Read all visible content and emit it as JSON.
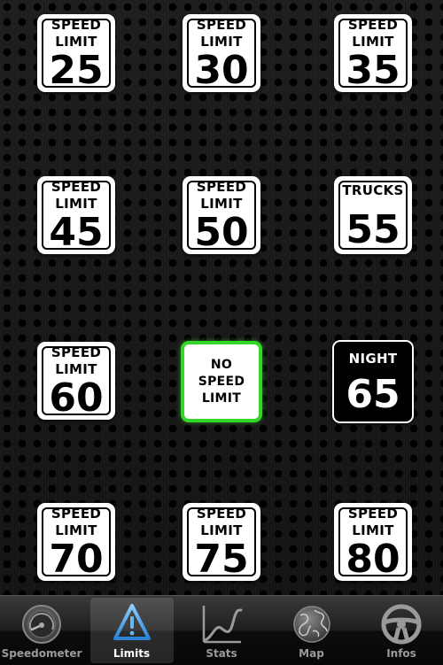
{
  "colors": {
    "selected_border": "#35d62a",
    "sign_background": "#ffffff",
    "night_sign_background": "#000000",
    "tab_active_icon": "#4aa3e6"
  },
  "signs": [
    {
      "line1": "SPEED",
      "line2": "LIMIT",
      "number": "25"
    },
    {
      "line1": "SPEED",
      "line2": "LIMIT",
      "number": "30"
    },
    {
      "line1": "SPEED",
      "line2": "LIMIT",
      "number": "35"
    },
    {
      "line1": "SPEED",
      "line2": "LIMIT",
      "number": "45"
    },
    {
      "line1": "SPEED",
      "line2": "LIMIT",
      "number": "50"
    },
    {
      "line1": "TRUCKS",
      "number": "55"
    },
    {
      "line1": "SPEED",
      "line2": "LIMIT",
      "number": "60"
    },
    {
      "line1": "NO",
      "line2": "SPEED",
      "line3": "LIMIT",
      "selected": true
    },
    {
      "line1": "NIGHT",
      "number": "65"
    },
    {
      "line1": "SPEED",
      "line2": "LIMIT",
      "number": "70"
    },
    {
      "line1": "SPEED",
      "line2": "LIMIT",
      "number": "75"
    },
    {
      "line1": "SPEED",
      "line2": "LIMIT",
      "number": "80"
    }
  ],
  "tabbar": {
    "active": "limits",
    "tabs": [
      {
        "id": "speedometer",
        "label": "Speedometer",
        "icon": "speedometer-icon"
      },
      {
        "id": "limits",
        "label": "Limits",
        "icon": "warning-triangle-icon"
      },
      {
        "id": "stats",
        "label": "Stats",
        "icon": "line-chart-icon"
      },
      {
        "id": "map",
        "label": "Map",
        "icon": "globe-icon"
      },
      {
        "id": "infos",
        "label": "Infos",
        "icon": "steering-wheel-icon"
      }
    ]
  }
}
